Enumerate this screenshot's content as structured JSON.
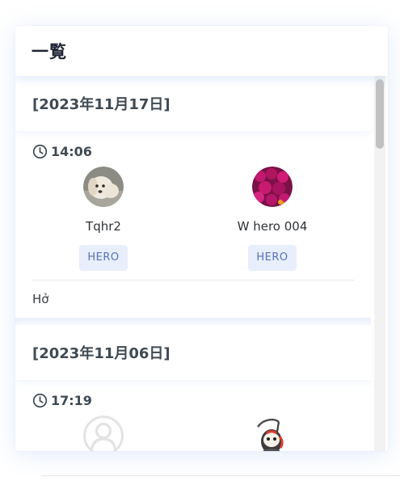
{
  "header": {
    "title": "一覧"
  },
  "entries": [
    {
      "date": "[2023年11月17日]",
      "time": "14:06",
      "players": [
        {
          "name": "Tqhr2",
          "badge": "HERO",
          "avatar": "dog-photo"
        },
        {
          "name": "W hero 004",
          "badge": "HERO",
          "avatar": "flower-photo"
        }
      ],
      "message": "Hở"
    },
    {
      "date": "[2023年11月06日]",
      "time": "17:19",
      "players": [
        {
          "name": "",
          "badge": "",
          "avatar": "default-user"
        },
        {
          "name": "",
          "badge": "",
          "avatar": "grim-reaper-character"
        }
      ],
      "message": ""
    }
  ],
  "colors": {
    "badge_bg": "#e8eefb",
    "badge_text": "#5571b9",
    "title_text": "#1e2433",
    "date_text": "#3f4a53"
  }
}
